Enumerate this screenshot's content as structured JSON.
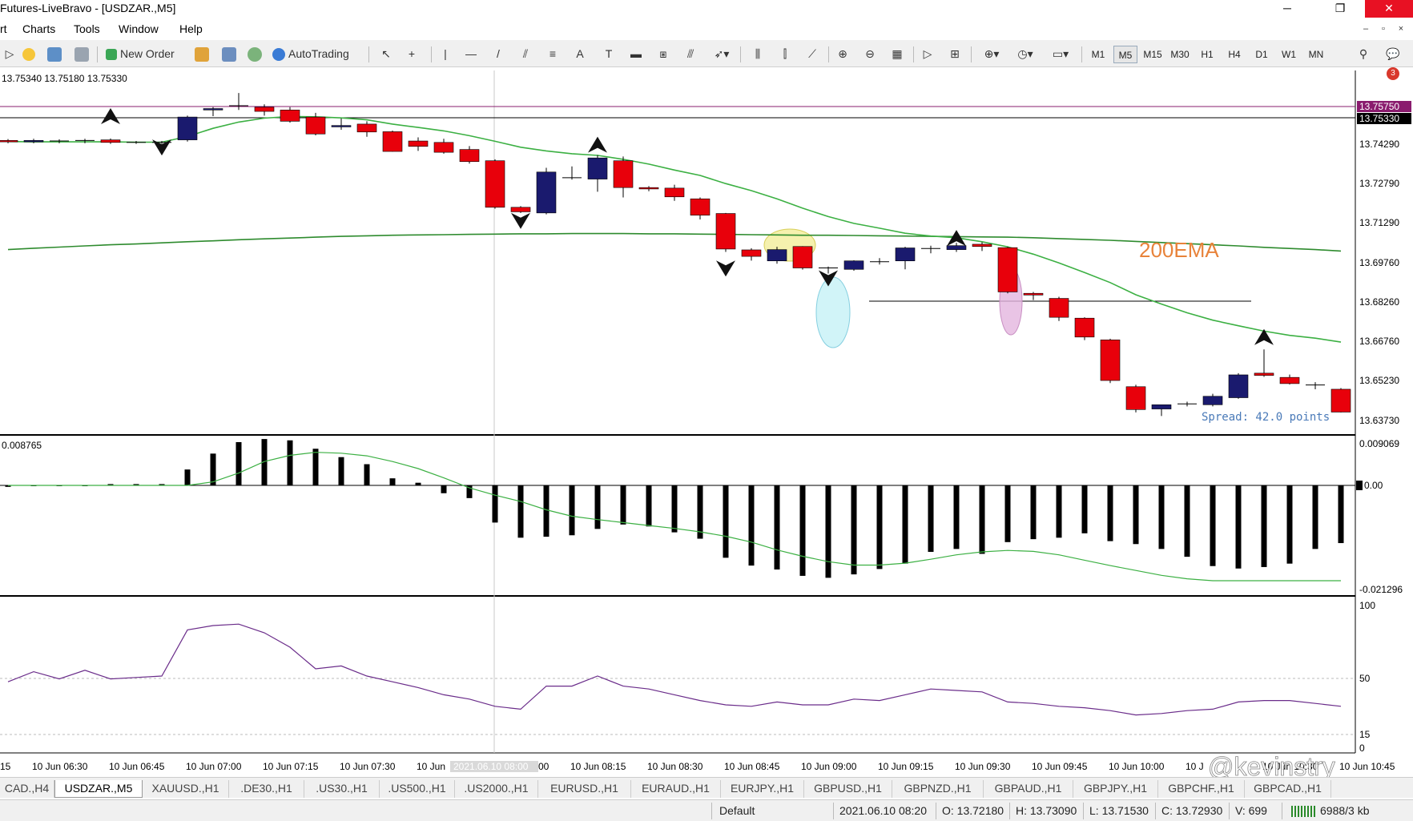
{
  "window": {
    "title": "Futures-LiveBravo - [USDZAR.,M5]",
    "minimize": "─",
    "restore": "❐",
    "close": "✕"
  },
  "menu": [
    "rt",
    "Charts",
    "Tools",
    "Window",
    "Help"
  ],
  "mdi_controls": [
    "–",
    "▫",
    "×"
  ],
  "toolbar": {
    "new_order": "New Order",
    "autotrading": "AutoTrading",
    "timeframes": [
      "M1",
      "M5",
      "M15",
      "M30",
      "H1",
      "H4",
      "D1",
      "W1",
      "MN"
    ],
    "active_timeframe": "M5",
    "notification_count": "3",
    "tool_glyphs": {
      "cursor": "↖",
      "crosshair": "+",
      "vline": "|",
      "hline": "—",
      "trendline": "/",
      "text": "A"
    }
  },
  "main_chart": {
    "ohlc_header": "13.75340 13.75180 13.75330",
    "price_labels": [
      "13.74290",
      "13.72790",
      "13.71290",
      "13.69760",
      "13.68260",
      "13.66760",
      "13.65230",
      "13.63730"
    ],
    "marker_prices": [
      "13.75750",
      "13.75330"
    ],
    "annotation": "200EMA",
    "spread": "Spread: 42.0 points",
    "colors": {
      "bull": "#1a1a6e",
      "bear": "#e8000b",
      "ema_fast": "#3cb043",
      "ema_200": "#2e8b2e",
      "annotation": "#e8833a"
    }
  },
  "macd_panel": {
    "header": "0.008765",
    "labels": [
      "0.009069",
      "0.00",
      "-0.021296"
    ]
  },
  "osc_panel": {
    "labels": [
      "100",
      "50",
      "15",
      "0"
    ]
  },
  "time_axis": [
    "15",
    "10 Jun 06:30",
    "10 Jun 06:45",
    "10 Jun 07:00",
    "10 Jun 07:15",
    "10 Jun 07:30",
    "10 Jun",
    "2021.06.10 08:00",
    "00",
    "10 Jun 08:15",
    "10 Jun 08:30",
    "10 Jun 08:45",
    "10 Jun 09:00",
    "10 Jun 09:15",
    "10 Jun 09:30",
    "10 Jun 09:45",
    "10 Jun 10:00",
    "10 J",
    "10 Jun 10:30",
    "10 Jun 10:45"
  ],
  "watermark": "@kevinstry",
  "symbol_tabs": [
    "CAD.,H4",
    "USDZAR.,M5",
    "XAUUSD.,H1",
    ".DE30.,H1",
    ".US30.,H1",
    ".US500.,H1",
    ".US2000.,H1",
    "EURUSD.,H1",
    "EURAUD.,H1",
    "EURJPY.,H1",
    "GBPUSD.,H1",
    "GBPNZD.,H1",
    "GBPAUD.,H1",
    "GBPJPY.,H1",
    "GBPCHF.,H1",
    "GBPCAD.,H1"
  ],
  "active_tab": "USDZAR.,M5",
  "status": {
    "profile": "Default",
    "datetime": "2021.06.10 08:20",
    "open": "O: 13.72180",
    "high": "H: 13.73090",
    "low": "L: 13.71530",
    "close": "C: 13.72930",
    "volume": "V: 699",
    "traffic": "6988/3 kb"
  },
  "chart_data": {
    "type": "candlestick",
    "symbol": "USDZAR.,M5",
    "candles_ohlc": [
      [
        13.7362,
        13.7367,
        13.7352,
        13.7357
      ],
      [
        13.7357,
        13.7368,
        13.7352,
        13.7362
      ],
      [
        13.7358,
        13.7366,
        13.7352,
        13.736
      ],
      [
        13.7358,
        13.7368,
        13.7352,
        13.7362
      ],
      [
        13.7364,
        13.7369,
        13.735,
        13.7355
      ],
      [
        13.7355,
        13.736,
        13.735,
        13.7355
      ],
      [
        13.7355,
        13.736,
        13.735,
        13.7355
      ],
      [
        13.7364,
        13.745,
        13.7358,
        13.7445
      ],
      [
        13.747,
        13.748,
        13.7448,
        13.7475
      ],
      [
        13.7485,
        13.753,
        13.747,
        13.7485
      ],
      [
        13.748,
        13.749,
        13.745,
        13.7465
      ],
      [
        13.747,
        13.748,
        13.7425,
        13.743
      ],
      [
        13.7445,
        13.746,
        13.738,
        13.7385
      ],
      [
        13.741,
        13.744,
        13.74,
        13.7415
      ],
      [
        13.742,
        13.743,
        13.7375,
        13.7392
      ],
      [
        13.7393,
        13.7397,
        13.7322,
        13.7323
      ],
      [
        13.736,
        13.7373,
        13.7325,
        13.7341
      ],
      [
        13.7355,
        13.7368,
        13.7315,
        13.732
      ],
      [
        13.733,
        13.7342,
        13.728,
        13.7287
      ],
      [
        13.729,
        13.7295,
        13.712,
        13.7125
      ],
      [
        13.7125,
        13.7129,
        13.7105,
        13.7109
      ],
      [
        13.7105,
        13.7265,
        13.71,
        13.725
      ],
      [
        13.7227,
        13.727,
        13.7223,
        13.723
      ],
      [
        13.7225,
        13.731,
        13.718,
        13.73
      ],
      [
        13.729,
        13.7305,
        13.716,
        13.7195
      ],
      [
        13.7195,
        13.72,
        13.7182,
        13.719
      ],
      [
        13.7193,
        13.7205,
        13.7148,
        13.7162
      ],
      [
        13.7155,
        13.716,
        13.7082,
        13.7097
      ],
      [
        13.7103,
        13.7105,
        13.6967,
        13.6977
      ],
      [
        13.6974,
        13.698,
        13.6936,
        13.6951
      ],
      [
        13.6935,
        13.6985,
        13.6925,
        13.6975
      ],
      [
        13.6986,
        13.6987,
        13.6904,
        13.691
      ],
      [
        13.691,
        13.6915,
        13.689,
        13.6908
      ],
      [
        13.6905,
        13.6937,
        13.69,
        13.6935
      ],
      [
        13.6932,
        13.6945,
        13.6922,
        13.6932
      ],
      [
        13.6935,
        13.6985,
        13.6905,
        13.6981
      ],
      [
        13.6979,
        13.6989,
        13.6962,
        13.6979
      ],
      [
        13.6975,
        13.6999,
        13.6967,
        13.6989
      ],
      [
        13.6994,
        13.7001,
        13.697,
        13.6986
      ],
      [
        13.6982,
        13.6985,
        13.682,
        13.6825
      ],
      [
        13.682,
        13.6825,
        13.6796,
        13.6814
      ],
      [
        13.6802,
        13.6808,
        13.6722,
        13.6735
      ],
      [
        13.6732,
        13.6735,
        13.6654,
        13.6665
      ],
      [
        13.6655,
        13.6659,
        13.6502,
        13.6511
      ],
      [
        13.6489,
        13.6496,
        13.6398,
        13.6408
      ],
      [
        13.641,
        13.6415,
        13.6385,
        13.6425
      ],
      [
        13.6428,
        13.6436,
        13.6419,
        13.6428
      ],
      [
        13.6425,
        13.6464,
        13.6419,
        13.6455
      ],
      [
        13.645,
        13.6537,
        13.6446,
        13.6531
      ],
      [
        13.6537,
        13.6621,
        13.6524,
        13.6529
      ],
      [
        13.6522,
        13.6532,
        13.6497,
        13.65
      ],
      [
        13.6495,
        13.6505,
        13.648,
        13.6492
      ],
      [
        13.648,
        13.6484,
        13.6398,
        13.6399
      ]
    ],
    "ema_fast": [
      13.7358,
      13.7357,
      13.7357,
      13.7357,
      13.7357,
      13.7356,
      13.7356,
      13.7376,
      13.7405,
      13.7427,
      13.7441,
      13.7447,
      13.7446,
      13.7442,
      13.7435,
      13.742,
      13.7408,
      13.7396,
      13.7379,
      13.7359,
      13.7338,
      13.7325,
      13.7315,
      13.7309,
      13.7295,
      13.7278,
      13.7257,
      13.7238,
      13.7209,
      13.7184,
      13.7155,
      13.7122,
      13.7092,
      13.7068,
      13.7051,
      13.7033,
      13.7023,
      13.7017,
      13.7003,
      13.6985,
      13.6959,
      13.6928,
      13.6894,
      13.6858,
      13.6815,
      13.6782,
      13.6751,
      13.6725,
      13.6705,
      13.6686,
      13.6671,
      13.6661,
      13.6647
    ],
    "ema_200": [
      13.6975,
      13.698,
      13.6984,
      13.6988,
      13.6992,
      13.6995,
      13.6999,
      13.7003,
      13.7006,
      13.701,
      13.7013,
      13.7016,
      13.7019,
      13.7022,
      13.7024,
      13.7026,
      13.7027,
      13.7028,
      13.7029,
      13.703,
      13.7031,
      13.7031,
      13.7032,
      13.7032,
      13.7032,
      13.7031,
      13.7031,
      13.703,
      13.7029,
      13.7028,
      13.7027,
      13.7026,
      13.7026,
      13.7025,
      13.7024,
      13.7023,
      13.7022,
      13.7021,
      13.702,
      13.7019,
      13.7017,
      13.7014,
      13.7011,
      13.7008,
      13.7004,
      13.7,
      13.6996,
      13.6992,
      13.6988,
      13.6983,
      13.6979,
      13.6975,
      13.697
    ],
    "macd_histogram": [
      -0.0003,
      0.0,
      0.0,
      0.0,
      0.0003,
      0.0003,
      0.0003,
      0.0036,
      0.0072,
      0.0098,
      0.0105,
      0.0102,
      0.0083,
      0.0064,
      0.0048,
      0.0016,
      0.0006,
      -0.0016,
      -0.0026,
      -0.0076,
      -0.0107,
      -0.0105,
      -0.0102,
      -0.0089,
      -0.008,
      -0.0084,
      -0.0096,
      -0.0109,
      -0.0148,
      -0.0164,
      -0.0172,
      -0.0185,
      -0.0189,
      -0.0182,
      -0.0171,
      -0.016,
      -0.0136,
      -0.013,
      -0.014,
      -0.0116,
      -0.011,
      -0.0107,
      -0.0098,
      -0.0114,
      -0.012,
      -0.013,
      -0.0146,
      -0.0165,
      -0.017,
      -0.0167,
      -0.016,
      -0.013,
      -0.0118
    ],
    "macd_signal": [
      0.0,
      0.0,
      0.0,
      0.0,
      0.0,
      0.0,
      0.0,
      0.0,
      0.0008,
      0.0028,
      0.0054,
      0.0068,
      0.0075,
      0.0073,
      0.0067,
      0.0054,
      0.0038,
      0.0017,
      -0.0005,
      -0.002,
      -0.0033,
      -0.005,
      -0.0063,
      -0.007,
      -0.0076,
      -0.0082,
      -0.0088,
      -0.0095,
      -0.0104,
      -0.0116,
      -0.0132,
      -0.0145,
      -0.0156,
      -0.0163,
      -0.0163,
      -0.0159,
      -0.0151,
      -0.0142,
      -0.0136,
      -0.0133,
      -0.0135,
      -0.0142,
      -0.0153,
      -0.0164,
      -0.0174,
      -0.0184,
      -0.0191,
      -0.0195,
      -0.0195,
      -0.0195,
      -0.0195,
      -0.0195,
      -0.0195
    ],
    "macd_levels": {
      "max": 0.009069,
      "min": -0.021296
    },
    "oscillator": [
      46,
      53,
      48,
      54,
      48,
      49,
      50,
      82,
      85,
      86,
      80,
      70,
      55,
      57,
      50,
      46,
      42,
      37,
      34,
      29,
      27,
      43,
      43,
      50,
      43,
      41,
      37,
      33,
      30,
      29,
      32,
      30,
      30,
      34,
      33,
      37,
      41,
      40,
      39,
      32,
      31,
      29,
      28,
      26,
      23,
      24,
      26,
      27,
      32,
      33,
      33,
      31,
      29
    ],
    "oscillator_levels": [
      0,
      15,
      50,
      100
    ],
    "y_range": [
      13.6318,
      13.761
    ]
  }
}
